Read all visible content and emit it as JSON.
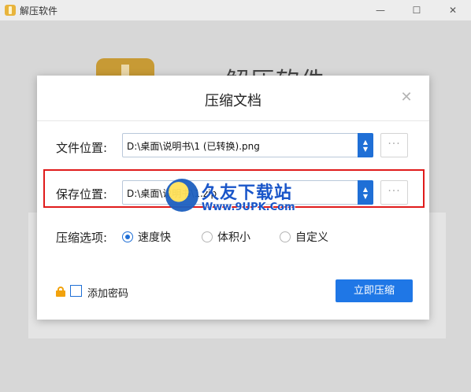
{
  "window": {
    "title": "解压软件",
    "controls": {
      "minimize": "—",
      "maximize": "☐",
      "close": "✕"
    }
  },
  "background": {
    "title": "解压软件"
  },
  "dialog": {
    "title": "压缩文档",
    "close": "✕",
    "file_location": {
      "label": "文件位置:",
      "value": "D:\\桌面\\说明书\\1 (已转换).png",
      "browse": "···"
    },
    "save_location": {
      "label": "保存位置:",
      "value": "D:\\桌面\\说明书\\1.zip",
      "browse": "···"
    },
    "compress_options": {
      "label": "压缩选项:",
      "options": [
        {
          "label": "速度快",
          "selected": true
        },
        {
          "label": "体积小",
          "selected": false
        },
        {
          "label": "自定义",
          "selected": false
        }
      ]
    },
    "add_password": {
      "label": "添加密码",
      "checked": false
    },
    "compress_button": "立即压缩"
  },
  "watermark": {
    "main": "久友下载站",
    "sub": "Www.9UPK.Com"
  },
  "colors": {
    "accent": "#1f77e6",
    "highlight": "#e01b1b",
    "lock": "#f2a20c"
  }
}
